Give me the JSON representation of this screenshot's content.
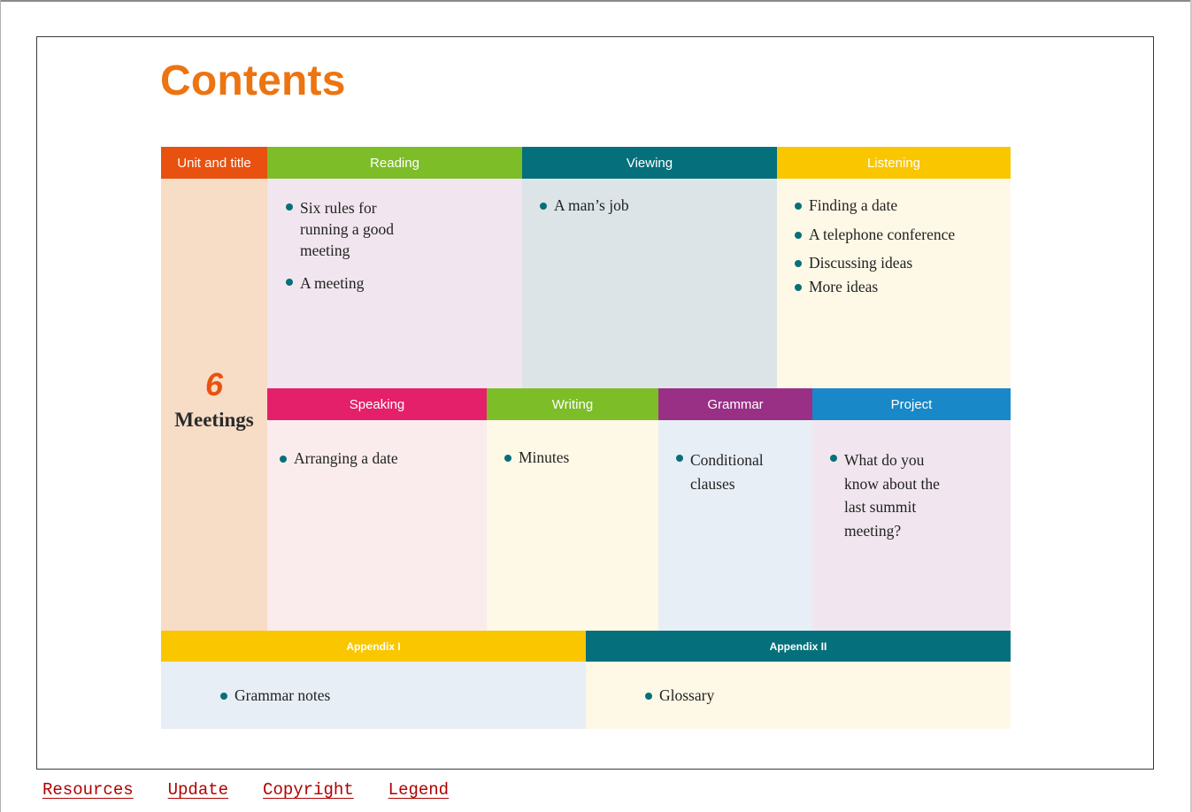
{
  "page": {
    "title": "Contents"
  },
  "headers": {
    "unit": "Unit and title",
    "reading": "Reading",
    "viewing": "Viewing",
    "listening": "Listening",
    "speaking": "Speaking",
    "writing": "Writing",
    "grammar": "Grammar",
    "project": "Project",
    "appendix1": "Appendix I",
    "appendix2": "Appendix II"
  },
  "unit": {
    "number": "6",
    "title": "Meetings"
  },
  "reading": [
    "Six rules for running a good meeting",
    "A meeting"
  ],
  "viewing": [
    "A man’s job"
  ],
  "listening": [
    "Finding a date",
    "A telephone conference",
    "Discussing ideas",
    "More ideas"
  ],
  "speaking": [
    "Arranging a date"
  ],
  "writing": [
    "Minutes"
  ],
  "grammar": [
    "Conditional clauses"
  ],
  "project": [
    "What do you know about the last summit meeting?"
  ],
  "appendix1": [
    "Grammar notes"
  ],
  "appendix2": [
    "Glossary"
  ],
  "footer_links": [
    "Resources",
    "Update",
    "Copyright",
    "Legend"
  ],
  "colors": {
    "title": "#ec7411",
    "unit_header": "#e8510f",
    "reading_header": "#7dbd28",
    "viewing_header": "#05707b",
    "listening_header": "#f9c600",
    "speaking_header": "#e4206a",
    "grammar_header": "#9a2f86",
    "project_header": "#1888c9",
    "bullet": "#06707a"
  }
}
